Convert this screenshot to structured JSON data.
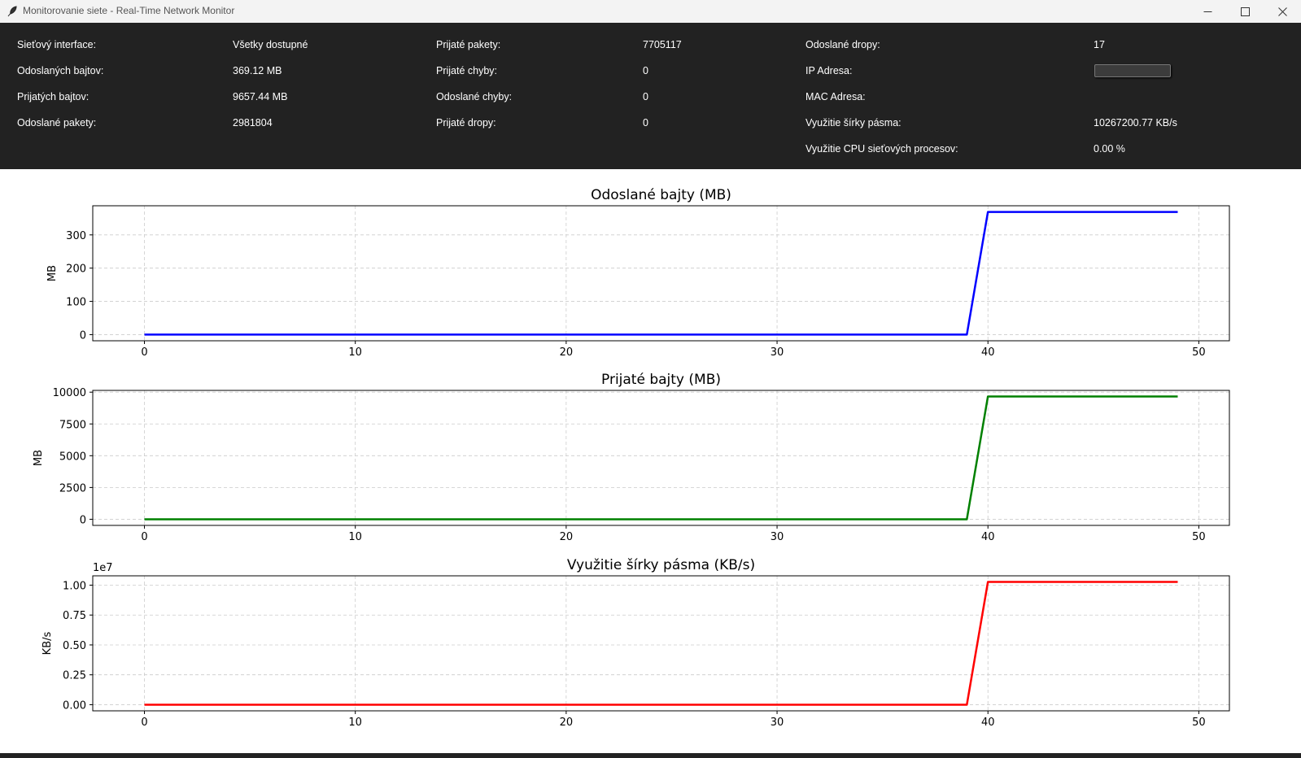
{
  "window": {
    "title": "Monitorovanie siete - Real-Time Network Monitor",
    "icon": "feather-icon",
    "controls": [
      "minimize-icon",
      "maximize-icon",
      "close-icon"
    ]
  },
  "info": {
    "columns": [
      [
        {
          "label": "Sieťový interface:",
          "value": "Všetky dostupné"
        },
        {
          "label": "Odoslaných bajtov:",
          "value": "369.12 MB"
        },
        {
          "label": "Prijatých bajtov:",
          "value": "9657.44 MB"
        },
        {
          "label": "Odoslané pakety:",
          "value": "2981804"
        }
      ],
      [
        {
          "label": "Prijaté pakety:",
          "value": "7705117"
        },
        {
          "label": "Prijaté chyby:",
          "value": "0"
        },
        {
          "label": "Odoslané chyby:",
          "value": "0"
        },
        {
          "label": "Prijaté dropy:",
          "value": "0"
        }
      ],
      [
        {
          "label": "Odoslané dropy:",
          "value": "17"
        },
        {
          "label": "IP Adresa:",
          "value": ""
        },
        {
          "label": "MAC Adresa:",
          "value": ""
        },
        {
          "label": "Využitie šírky pásma:",
          "value": "10267200.77 KB/s"
        },
        {
          "label": "Využitie CPU sieťových procesov:",
          "value": "0.00 %"
        }
      ]
    ]
  },
  "chart_data": [
    {
      "type": "line",
      "title": "Odoslané bajty (MB)",
      "xlabel": "",
      "ylabel": "MB",
      "xlim": [
        -2.45,
        51.45
      ],
      "ylim": [
        -18.5,
        387.6
      ],
      "xticks": [
        0,
        10,
        20,
        30,
        40,
        50
      ],
      "yticks": [
        0,
        100,
        200,
        300
      ],
      "yticklabels": [
        "0",
        "100",
        "200",
        "300"
      ],
      "offset_label": "",
      "grid": true,
      "color": "#0000ff",
      "x": [
        0,
        39,
        40,
        49
      ],
      "y": [
        0,
        0,
        369.12,
        369.12
      ]
    },
    {
      "type": "line",
      "title": "Prijaté bajty (MB)",
      "xlabel": "",
      "ylabel": "MB",
      "xlim": [
        -2.45,
        51.45
      ],
      "ylim": [
        -482.9,
        10140.3
      ],
      "xticks": [
        0,
        10,
        20,
        30,
        40,
        50
      ],
      "yticks": [
        0,
        2500,
        5000,
        7500,
        10000
      ],
      "yticklabels": [
        "0",
        "2500",
        "5000",
        "7500",
        "10000"
      ],
      "offset_label": "",
      "grid": true,
      "color": "#008000",
      "x": [
        0,
        39,
        40,
        49
      ],
      "y": [
        0,
        0,
        9657.44,
        9657.44
      ]
    },
    {
      "type": "line",
      "title": "Využitie šírky pásma (KB/s)",
      "xlabel": "",
      "ylabel": "KB/s",
      "xlim": [
        -2.45,
        51.45
      ],
      "ylim": [
        -513360,
        10780560
      ],
      "xticks": [
        0,
        10,
        20,
        30,
        40,
        50
      ],
      "yticks": [
        0,
        2500000,
        5000000,
        7500000,
        10000000
      ],
      "yticklabels": [
        "0.00",
        "0.25",
        "0.50",
        "0.75",
        "1.00"
      ],
      "offset_label": "1e7",
      "grid": true,
      "color": "#ff0000",
      "x": [
        0,
        39,
        40,
        49
      ],
      "y": [
        0,
        0,
        10267200.77,
        10267200.77
      ]
    }
  ]
}
